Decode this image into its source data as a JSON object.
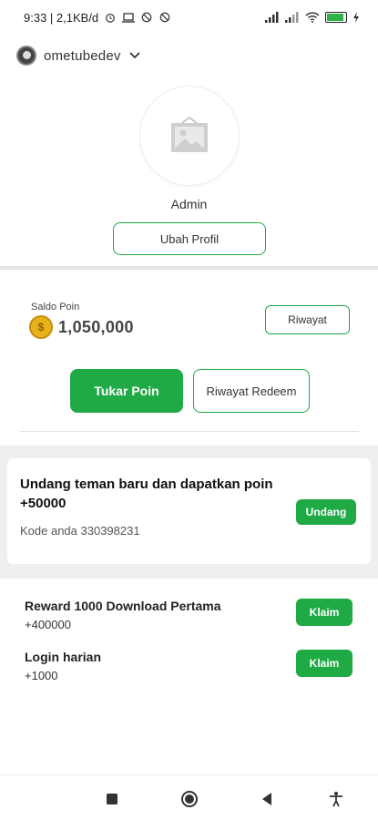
{
  "status_bar": {
    "time_speed": "9:33 | 2,1KB/d",
    "battery_level": 0.82
  },
  "account": {
    "username": "ometubedev"
  },
  "profile": {
    "name": "Admin",
    "edit_button": "Ubah Profil"
  },
  "points": {
    "label": "Saldo Poin",
    "value": "1,050,000",
    "history_button": "Riwayat",
    "exchange_button": "Tukar Poin",
    "redeem_history_button": "Riwayat Redeem"
  },
  "invite": {
    "title": "Undang teman baru dan dapatkan poin +50000",
    "code_text": "Kode anda 330398231",
    "button": "Undang"
  },
  "rewards": [
    {
      "title": "Reward 1000 Download Pertama",
      "amount": "+400000",
      "button": "Klaim"
    },
    {
      "title": "Login harian",
      "amount": "+1000",
      "button": "Klaim"
    }
  ],
  "colors": {
    "accent": "#1faa46",
    "coin": "#e8b21a"
  }
}
